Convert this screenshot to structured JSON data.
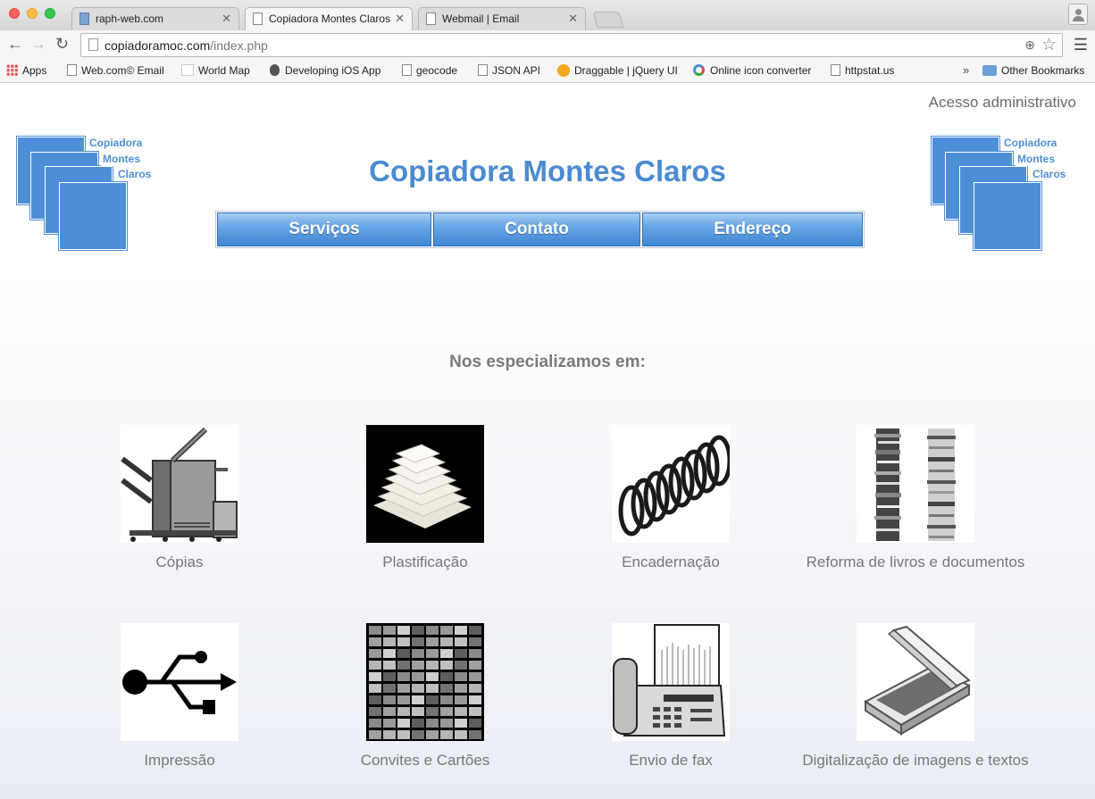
{
  "browser": {
    "tabs": [
      {
        "label": "raph-web.com",
        "active": false
      },
      {
        "label": "Copiadora Montes Claros",
        "active": true
      },
      {
        "label": "Webmail | Email",
        "active": false
      }
    ],
    "url": {
      "domain": "copiadoramoc.com",
      "path": "/index.php"
    },
    "bookmarks": [
      {
        "label": "Apps",
        "icon": "apps-icon"
      },
      {
        "label": "Web.com© Email",
        "icon": "page-icon"
      },
      {
        "label": "World Map",
        "icon": "map-icon"
      },
      {
        "label": "Developing iOS App",
        "icon": "apple-icon"
      },
      {
        "label": "geocode",
        "icon": "page-icon"
      },
      {
        "label": "JSON API",
        "icon": "page-icon"
      },
      {
        "label": "Draggable | jQuery UI",
        "icon": "jquery-icon"
      },
      {
        "label": "Online icon converter",
        "icon": "converter-icon"
      },
      {
        "label": "httpstat.us",
        "icon": "page-icon"
      }
    ],
    "bookmarks_more": "»",
    "other_bookmarks": "Other Bookmarks"
  },
  "page": {
    "admin_link": "Acesso administrativo",
    "title": "Copiadora Montes Claros",
    "logo": {
      "line1": "Copiadora",
      "line2": "Montes",
      "line3": "Claros",
      "color": "#4d8fd6"
    },
    "menu": [
      "Serviços",
      "Contato",
      "Endereço"
    ],
    "tagline": "Nos especializamos em:",
    "services": [
      {
        "label": "Cópias",
        "icon": "copier-icon"
      },
      {
        "label": "Plastificação",
        "icon": "laminate-sheets-icon"
      },
      {
        "label": "Encadernação",
        "icon": "binding-spiral-icon"
      },
      {
        "label": "Reforma de livros e documentos",
        "icon": "book-stacks-icon"
      },
      {
        "label": "Impressão",
        "icon": "usb-icon"
      },
      {
        "label": "Convites e Cartões",
        "icon": "cards-grid-icon"
      },
      {
        "label": "Envio de fax",
        "icon": "fax-icon"
      },
      {
        "label": "Digitalização de imagens e textos",
        "icon": "scanner-icon"
      }
    ]
  }
}
